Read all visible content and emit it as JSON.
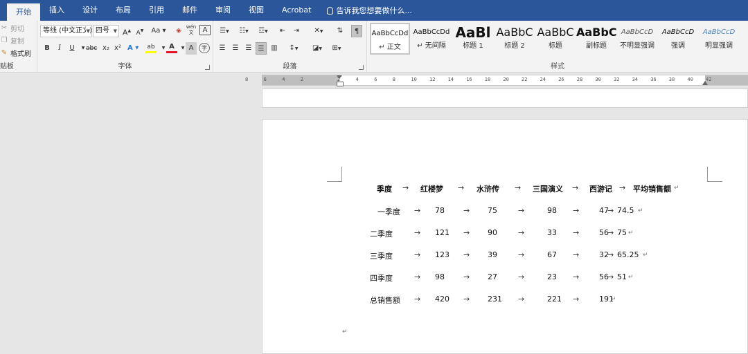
{
  "tabs": [
    "开始",
    "插入",
    "设计",
    "布局",
    "引用",
    "邮件",
    "审阅",
    "视图",
    "Acrobat"
  ],
  "tell_me": "告诉我您想要做什么...",
  "clipboard": {
    "cut": "剪切",
    "copy": "复制",
    "format_painter": "格式刷",
    "label": "贴板"
  },
  "font": {
    "family": "等线 (中文正文)",
    "size": "四号",
    "label": "字体",
    "grow": "A",
    "shrink": "A",
    "case": "Aa",
    "phonetic": "wén",
    "border_char": "A",
    "bold": "B",
    "italic": "I",
    "underline": "U",
    "strike": "abc",
    "sub": "x₂",
    "sup": "x²",
    "effects": "A",
    "highlight": "ab",
    "color": "A",
    "shade": "A",
    "circle": "字"
  },
  "paragraph": {
    "label": "段落"
  },
  "styles": {
    "label": "样式",
    "items": [
      {
        "sample": "AaBbCcDd",
        "name": "↵ 正文"
      },
      {
        "sample": "AaBbCcDd",
        "name": "↵ 无间隔"
      },
      {
        "sample": "AaBl",
        "name": "标题 1"
      },
      {
        "sample": "AaBbC",
        "name": "标题 2"
      },
      {
        "sample": "AaBbC",
        "name": "标题"
      },
      {
        "sample": "AaBbC",
        "name": "副标题"
      },
      {
        "sample": "AaBbCcD",
        "name": "不明显强调"
      },
      {
        "sample": "AaBbCcD",
        "name": "强调"
      },
      {
        "sample": "AaBbCcD",
        "name": "明显强调"
      }
    ]
  },
  "ruler": {
    "ticks": [
      "8",
      "6",
      "4",
      "2",
      "",
      "2",
      "4",
      "6",
      "8",
      "10",
      "12",
      "14",
      "16",
      "18",
      "20",
      "22",
      "24",
      "26",
      "28",
      "30",
      "32",
      "34",
      "36",
      "38",
      "40",
      "42"
    ]
  },
  "table": {
    "headers": [
      "季度",
      "红楼梦",
      "水浒传",
      "三国演义",
      "西游记",
      "平均销售额"
    ],
    "rows": [
      [
        "一季度",
        "78",
        "75",
        "98",
        "47",
        "74.5"
      ],
      [
        "二季度",
        "121",
        "90",
        "33",
        "56",
        "75"
      ],
      [
        "三季度",
        "123",
        "39",
        "67",
        "32",
        "65.25"
      ],
      [
        "四季度",
        "98",
        "27",
        "23",
        "56",
        "51"
      ],
      [
        "总销售额",
        "420",
        "231",
        "221",
        "191",
        ""
      ]
    ]
  },
  "symbols": {
    "tab": "→",
    "para": "↵"
  },
  "colors": {
    "accent": "#2b579a",
    "ribbon": "#f3f3f3",
    "canvas": "#e6e6e6"
  }
}
